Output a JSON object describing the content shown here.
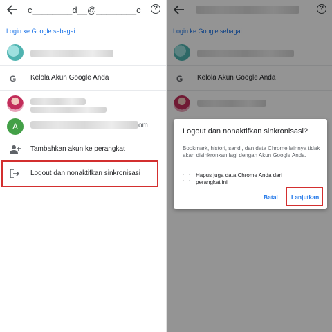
{
  "left_panel": {
    "header": {
      "email": "c________d__@________c"
    },
    "section_label": "Login ke Google sebagai",
    "accounts": [
      {
        "email_visible": ""
      },
      {
        "email_visible": ""
      },
      {
        "avatar_letter": "A",
        "email_tail": "om"
      }
    ],
    "manage_label": "Kelola Akun Google Anda",
    "add_account_label": "Tambahkan akun ke perangkat",
    "logout_label": "Logout dan nonaktifkan sinkronisasi"
  },
  "right_panel": {
    "section_label": "Login ke Google sebagai",
    "manage_label": "Kelola Akun Google Anda",
    "dialog": {
      "title": "Logout dan nonaktifkan sinkronisasi?",
      "body": "Bookmark, histori, sandi, dan data Chrome lainnya tidak akan disinkronkan lagi dengan Akun Google Anda.",
      "checkbox_label": "Hapus juga data Chrome Anda dari perangkat ini",
      "cancel_label": "Batal",
      "confirm_label": "Lanjutkan"
    }
  },
  "colors": {
    "accent": "#1a73e8",
    "highlight": "#d32f2f",
    "scrim": "rgba(0,0,0,0.42)"
  }
}
